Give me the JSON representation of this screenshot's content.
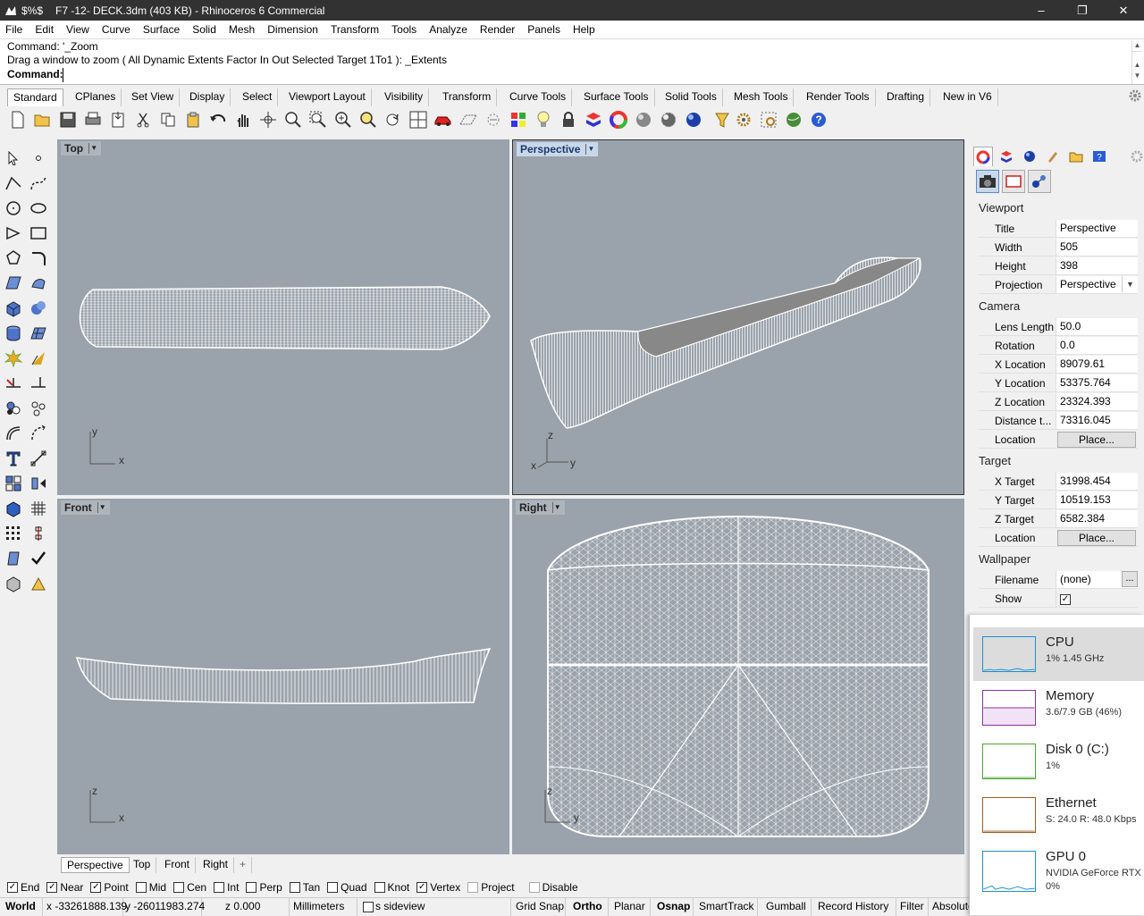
{
  "window": {
    "title_marks": "$%$",
    "title": "F7 -12- DECK.3dm (403 KB) - Rhinoceros 6 Commercial",
    "controls": [
      "–",
      "❐",
      "✕"
    ]
  },
  "menu": [
    "File",
    "Edit",
    "View",
    "Curve",
    "Surface",
    "Solid",
    "Mesh",
    "Dimension",
    "Transform",
    "Tools",
    "Analyze",
    "Render",
    "Panels",
    "Help"
  ],
  "command": {
    "history_1": "Command: '_Zoom",
    "history_2": "Drag a window to zoom ( All  Dynamic  Extents  Factor  In  Out  Selected  Target  1To1 ): _Extents",
    "prompt_label": "Command:",
    "input_value": ""
  },
  "toolbar_tabs": [
    "Standard",
    "CPlanes",
    "Set View",
    "Display",
    "Select",
    "Viewport Layout",
    "Visibility",
    "Transform",
    "Curve Tools",
    "Surface Tools",
    "Solid Tools",
    "Mesh Tools",
    "Render Tools",
    "Drafting",
    "New in V6"
  ],
  "toolbar_icons": [
    "new-icon",
    "open-icon",
    "save-icon",
    "print-icon",
    "import-icon",
    "cut-icon",
    "copy-icon",
    "paste-icon",
    "undo-icon",
    "pan-icon",
    "rotate-view-icon",
    "zoom-icon",
    "zoom-window-icon",
    "zoom-extents-icon",
    "zoom-selected-icon",
    "rotate-icon",
    "four-viewports-icon",
    "car-icon",
    "cplane-icon",
    "hide-icon",
    "light-icon",
    "lock-icon",
    "layer-icon",
    "color-wheel-icon",
    "shade-icon",
    "rendered-icon",
    "render-sphere-icon",
    "options-icon",
    "settings-icon",
    "gear-options-icon",
    "planet-icon",
    "help-icon"
  ],
  "viewports": {
    "top": {
      "label": "Top",
      "axis_a": "y",
      "axis_b": "x"
    },
    "perspective": {
      "label": "Perspective",
      "axis_a": "z",
      "axis_b": "y",
      "axis_c": "x"
    },
    "front": {
      "label": "Front",
      "axis_a": "z",
      "axis_b": "x"
    },
    "right": {
      "label": "Right",
      "axis_a": "z",
      "axis_b": "y"
    }
  },
  "viewport_tabs": [
    "Perspective",
    "Top",
    "Front",
    "Right"
  ],
  "viewport_tab_add": "+",
  "osnap": [
    {
      "label": "End",
      "checked": true
    },
    {
      "label": "Near",
      "checked": true
    },
    {
      "label": "Point",
      "checked": true
    },
    {
      "label": "Mid",
      "checked": false
    },
    {
      "label": "Cen",
      "checked": false
    },
    {
      "label": "Int",
      "checked": false
    },
    {
      "label": "Perp",
      "checked": false
    },
    {
      "label": "Tan",
      "checked": false
    },
    {
      "label": "Quad",
      "checked": false
    },
    {
      "label": "Knot",
      "checked": false
    },
    {
      "label": "Vertex",
      "checked": true
    },
    {
      "label": "Project",
      "checked": false,
      "disabled": true
    },
    {
      "label": "Disable",
      "checked": false,
      "disabled": true
    }
  ],
  "status": {
    "cplane": "World",
    "x": "x -33261888.139",
    "y": "y -26011983.274",
    "z": "z 0.000",
    "units": "Millimeters",
    "layer": "s sideview",
    "grid_snap": "Grid Snap",
    "ortho": "Ortho",
    "planar": "Planar",
    "osnap": "Osnap",
    "smarttrack": "SmartTrack",
    "gumball": "Gumball",
    "record_history": "Record History",
    "filter": "Filter",
    "absolute": "Absolute"
  },
  "properties": {
    "viewport_header": "Viewport",
    "title_label": "Title",
    "title_value": "Perspective",
    "width_label": "Width",
    "width_value": "505",
    "height_label": "Height",
    "height_value": "398",
    "projection_label": "Projection",
    "projection_value": "Perspective",
    "camera_header": "Camera",
    "lens_label": "Lens Length",
    "lens_value": "50.0",
    "rotation_label": "Rotation",
    "rotation_value": "0.0",
    "xloc_label": "X Location",
    "xloc_value": "89079.61",
    "yloc_label": "Y Location",
    "yloc_value": "53375.764",
    "zloc_label": "Z Location",
    "zloc_value": "23324.393",
    "dist_label": "Distance t...",
    "dist_value": "73316.045",
    "loc_label": "Location",
    "place_button": "Place...",
    "target_header": "Target",
    "xt_label": "X Target",
    "xt_value": "31998.454",
    "yt_label": "Y Target",
    "yt_value": "10519.153",
    "zt_label": "Z Target",
    "zt_value": "6582.384",
    "tloc_label": "Location",
    "tplace_button": "Place...",
    "wallpaper_header": "Wallpaper",
    "filename_label": "Filename",
    "filename_value": "(none)",
    "browse_button": "...",
    "show_label": "Show",
    "show_checked": true
  },
  "task_manager": [
    {
      "name": "CPU",
      "detail": "1%  1.45 GHz",
      "color": "#1e8fcf",
      "level": 0.01,
      "selected": true
    },
    {
      "name": "Memory",
      "detail": "3.6/7.9 GB (46%)",
      "color": "#8b2fa3",
      "level": 0.46,
      "selected": false
    },
    {
      "name": "Disk 0 (C:)",
      "detail": "1%",
      "color": "#4aa62b",
      "level": 0.01,
      "selected": false
    },
    {
      "name": "Ethernet",
      "detail": "S: 24.0  R: 48.0 Kbps",
      "color": "#a7591c",
      "level": 0.0,
      "selected": false
    },
    {
      "name": "GPU 0",
      "detail": "NVIDIA GeForce RTX",
      "detail2": "0%",
      "color": "#1e8fcf",
      "level": 0.0,
      "selected": false
    }
  ]
}
